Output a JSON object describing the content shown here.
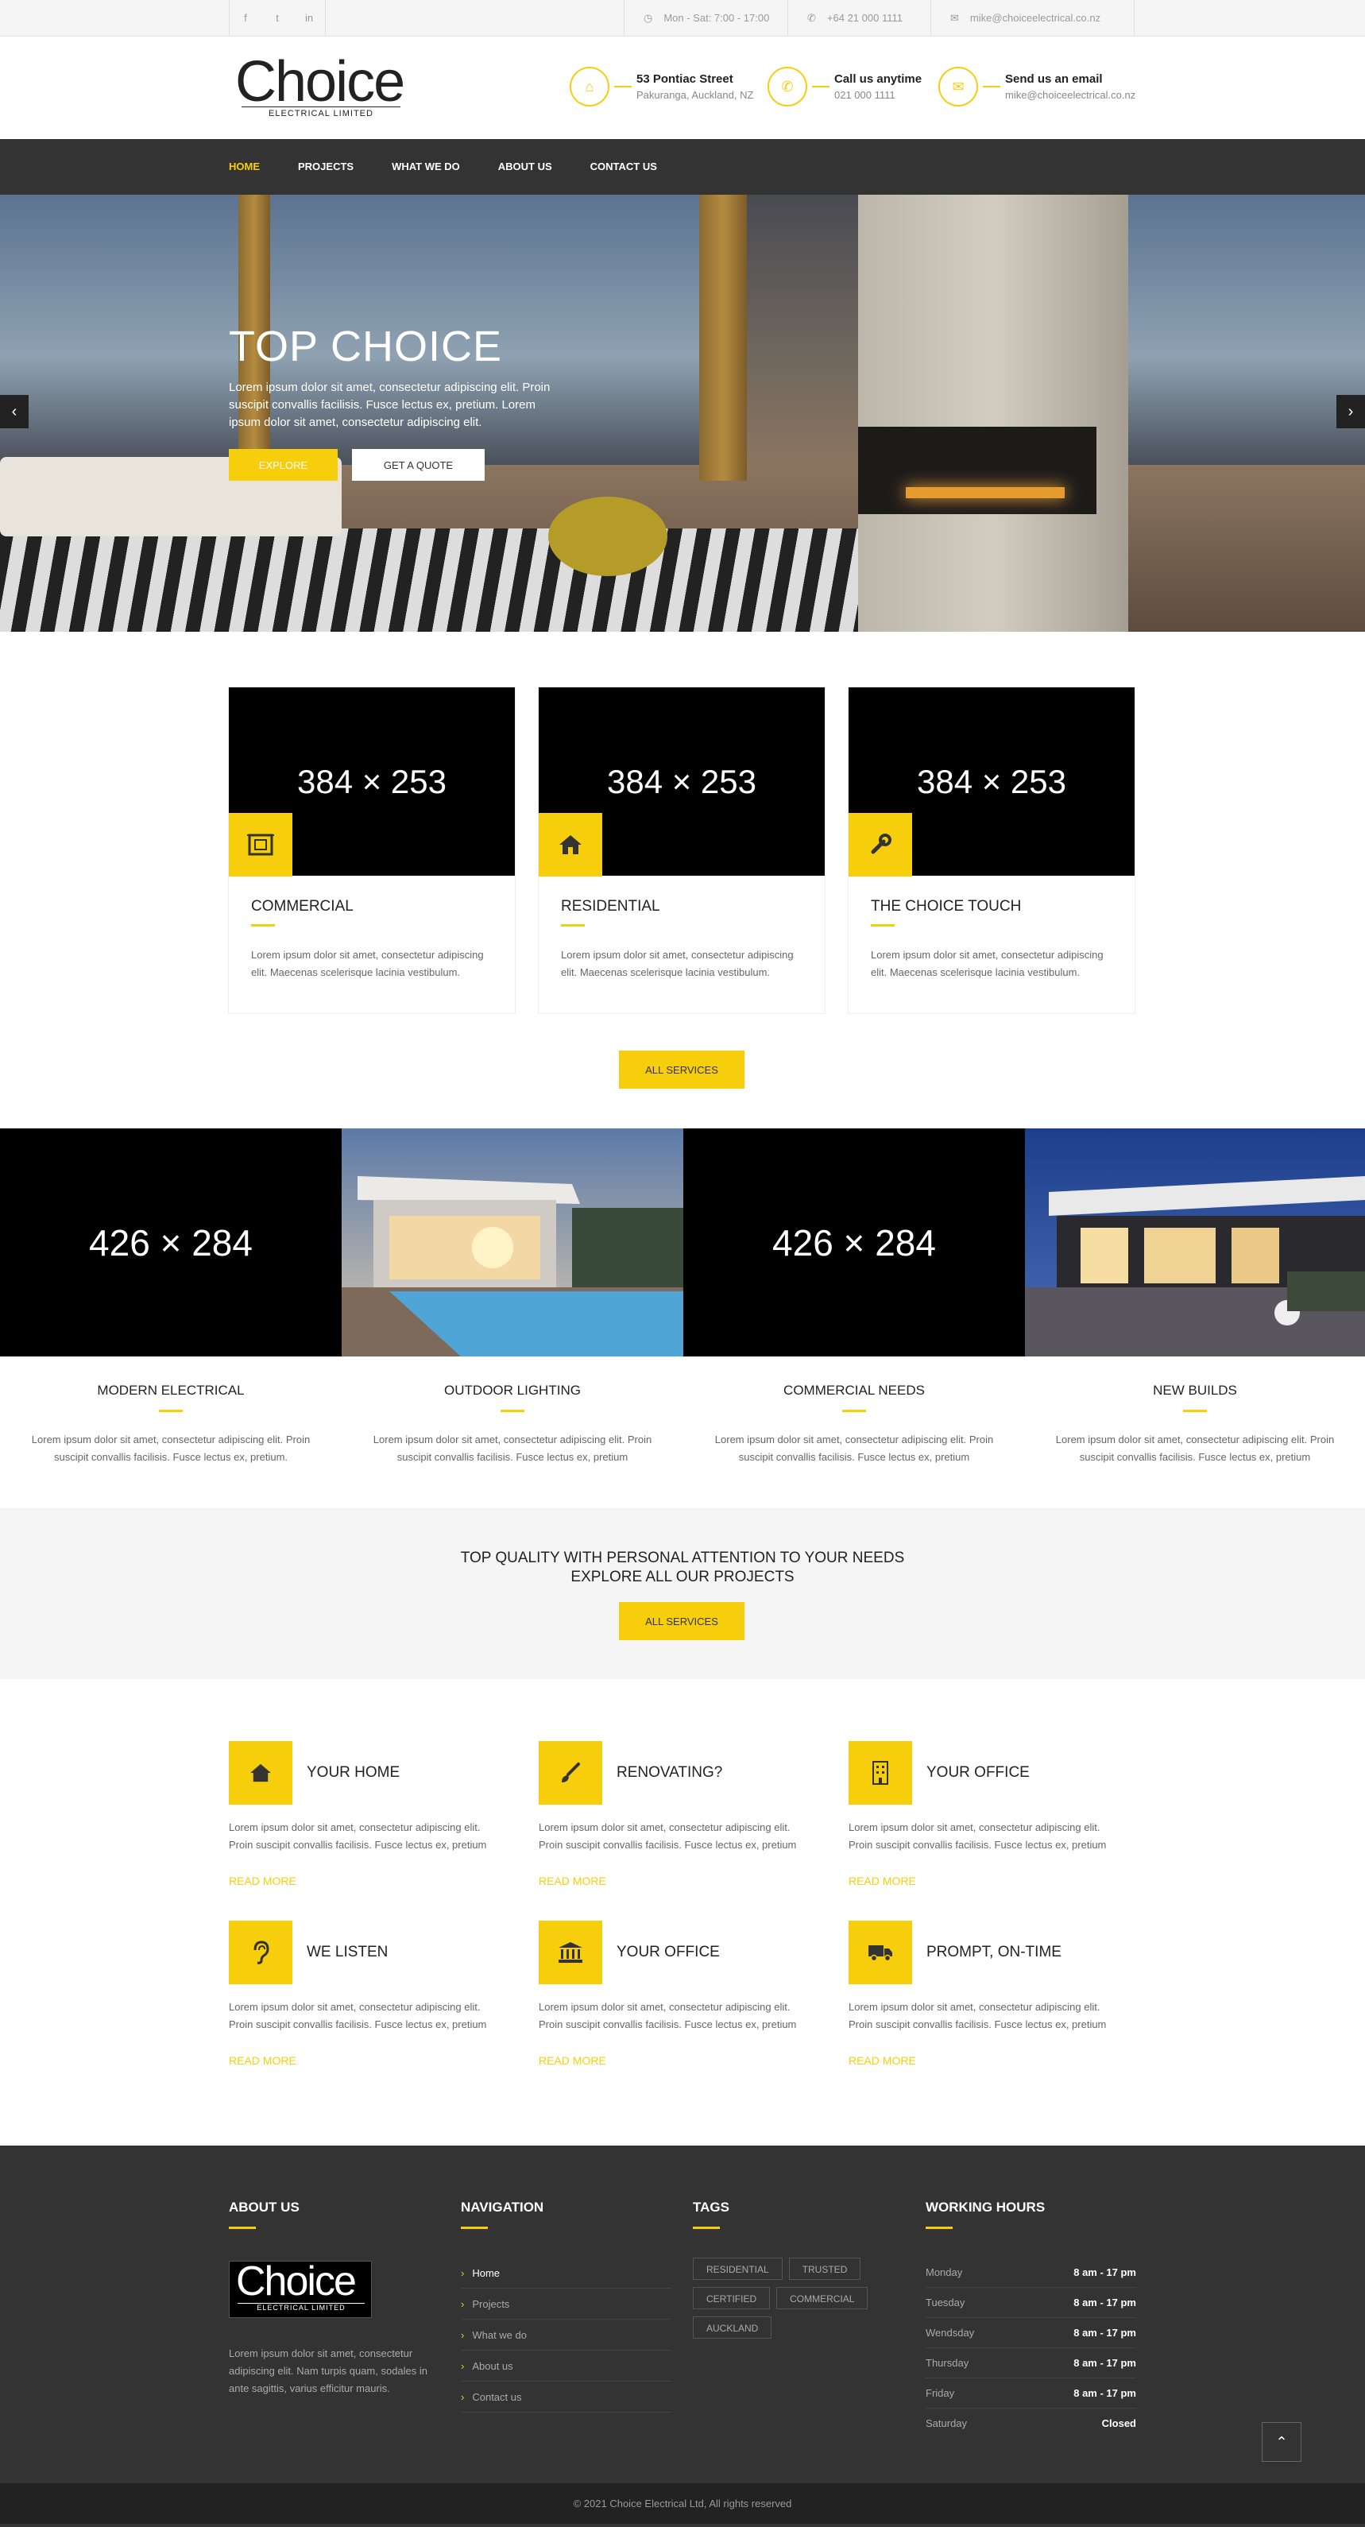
{
  "topbar": {
    "social": [
      {
        "icon": "facebook-icon",
        "glyph": "f"
      },
      {
        "icon": "twitter-icon",
        "glyph": "t"
      },
      {
        "icon": "linkedin-icon",
        "glyph": "in"
      }
    ],
    "hours": "Mon - Sat: 7:00 - 17:00",
    "phone": "+64 21 000 1111",
    "email": "mike@choiceelectrical.co.nz"
  },
  "header": {
    "logo_text": "Choice",
    "logo_sub": "ELECTRICAL LIMITED",
    "address_title": "53 Pontiac Street",
    "address_sub": "Pakuranga, Auckland, NZ",
    "call_title": "Call us anytime",
    "call_sub": "021 000 1111",
    "email_title": "Send us an email",
    "email_sub": "mike@choiceelectrical.co.nz"
  },
  "nav": [
    "HOME",
    "PROJECTS",
    "WHAT WE DO",
    "ABOUT US",
    "CONTACT US"
  ],
  "hero": {
    "title": "TOP CHOICE",
    "text": "Lorem ipsum dolor sit amet, consectetur adipiscing elit. Proin suscipit convallis facilisis. Fusce lectus ex, pretium. Lorem ipsum dolor sit amet, consectetur adipiscing elit.",
    "explore": "EXPLORE",
    "quote": "GET A QUOTE",
    "prev": "‹",
    "next": "›"
  },
  "services": [
    {
      "img": "384 × 253",
      "title": "COMMERCIAL",
      "text": "Lorem ipsum dolor sit amet, consectetur adipiscing elit. Maecenas scelerisque lacinia vestibulum."
    },
    {
      "img": "384 × 253",
      "title": "RESIDENTIAL",
      "text": "Lorem ipsum dolor sit amet, consectetur adipiscing elit. Maecenas scelerisque lacinia vestibulum."
    },
    {
      "img": "384 × 253",
      "title": "THE CHOICE TOUCH",
      "text": "Lorem ipsum dolor sit amet, consectetur adipiscing elit. Maecenas scelerisque lacinia vestibulum."
    }
  ],
  "all_services": "ALL SERVICES",
  "projects": [
    {
      "img": "426 × 284",
      "title": "MODERN ELECTRICAL",
      "text": "Lorem ipsum dolor sit amet, consectetur adipiscing elit. Proin suscipit convallis facilisis. Fusce lectus ex, pretium."
    },
    {
      "img": "",
      "title": "OUTDOOR LIGHTING",
      "text": "Lorem ipsum dolor sit amet, consectetur adipiscing elit. Proin suscipit convallis facilisis. Fusce lectus ex, pretium"
    },
    {
      "img": "426 × 284",
      "title": "COMMERCIAL NEEDS",
      "text": "Lorem ipsum dolor sit amet, consectetur adipiscing elit. Proin suscipit convallis facilisis. Fusce lectus ex, pretium"
    },
    {
      "img": "",
      "title": "NEW BUILDS",
      "text": "Lorem ipsum dolor sit amet, consectetur adipiscing elit. Proin suscipit convallis facilisis. Fusce lectus ex, pretium"
    }
  ],
  "cta": {
    "line1": "TOP QUALITY WITH PERSONAL ATTENTION TO YOUR NEEDS",
    "line2": "EXPLORE ALL OUR PROJECTS",
    "button": "ALL SERVICES"
  },
  "features": [
    {
      "icon": "home-icon",
      "title": "YOUR HOME",
      "text": "Lorem ipsum dolor sit amet, consectetur adipiscing elit. Proin suscipit convallis facilisis. Fusce lectus ex, pretium",
      "more": "READ MORE"
    },
    {
      "icon": "paintbrush-icon",
      "title": "RENOVATING?",
      "text": "Lorem ipsum dolor sit amet, consectetur adipiscing elit. Proin suscipit convallis facilisis. Fusce lectus ex, pretium",
      "more": "READ MORE"
    },
    {
      "icon": "building-icon",
      "title": "YOUR OFFICE",
      "text": "Lorem ipsum dolor sit amet, consectetur adipiscing elit. Proin suscipit convallis facilisis. Fusce lectus ex, pretium",
      "more": "READ MORE"
    },
    {
      "icon": "ear-icon",
      "title": "WE LISTEN",
      "text": "Lorem ipsum dolor sit amet, consectetur adipiscing elit. Proin suscipit convallis facilisis. Fusce lectus ex, pretium",
      "more": "READ MORE"
    },
    {
      "icon": "bank-icon",
      "title": "YOUR OFFICE",
      "text": "Lorem ipsum dolor sit amet, consectetur adipiscing elit. Proin suscipit convallis facilisis. Fusce lectus ex, pretium",
      "more": "READ MORE"
    },
    {
      "icon": "truck-icon",
      "title": "PROMPT, ON-TIME",
      "text": "Lorem ipsum dolor sit amet, consectetur adipiscing elit. Proin suscipit convallis facilisis. Fusce lectus ex, pretium",
      "more": "READ MORE"
    }
  ],
  "footer": {
    "about_title": "ABOUT US",
    "about_text": "Lorem ipsum dolor sit amet, consectetur adipiscing elit. Nam turpis quam, sodales in ante sagittis, varius efficitur mauris.",
    "nav_title": "NAVIGATION",
    "nav_items": [
      "Home",
      "Projects",
      "What we do",
      "About us",
      "Contact us"
    ],
    "tags_title": "TAGS",
    "tags": [
      "RESIDENTIAL",
      "TRUSTED",
      "CERTIFIED",
      "COMMERCIAL",
      "AUCKLAND"
    ],
    "hours_title": "WORKING HOURS",
    "hours": [
      {
        "day": "Monday",
        "time": "8 am - 17 pm"
      },
      {
        "day": "Tuesday",
        "time": "8 am - 17 pm"
      },
      {
        "day": "Wendsday",
        "time": "8 am - 17 pm"
      },
      {
        "day": "Thursday",
        "time": "8 am - 17 pm"
      },
      {
        "day": "Friday",
        "time": "8 am - 17 pm"
      },
      {
        "day": "Saturday",
        "time": "Closed"
      }
    ],
    "copyright": "© 2021 Choice Electrical Ltd, All rights reserved",
    "to_top": "⌃"
  },
  "colors": {
    "accent": "#f7ce0b",
    "dark": "#333333"
  }
}
